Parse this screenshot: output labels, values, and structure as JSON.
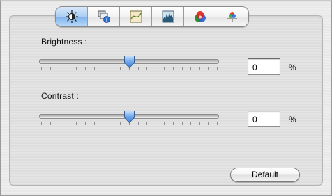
{
  "toolbar": {
    "tabs": [
      {
        "icon": "brightness-contrast-icon",
        "active": true
      },
      {
        "icon": "overlay-icon",
        "active": false
      },
      {
        "icon": "curve-icon",
        "active": false
      },
      {
        "icon": "histogram-icon",
        "active": false
      },
      {
        "icon": "color-wheel-icon",
        "active": false
      },
      {
        "icon": "color-balance-icon",
        "active": false
      }
    ]
  },
  "brightness": {
    "label": "Brightness :",
    "value": "0",
    "unit": "%",
    "slider_fraction": 0.5
  },
  "contrast": {
    "label": "Contrast :",
    "value": "0",
    "unit": "%",
    "slider_fraction": 0.5
  },
  "actions": {
    "default_label": "Default"
  },
  "colors": {
    "accent": "#7fb2ea",
    "thumb": "#4a86d4"
  }
}
